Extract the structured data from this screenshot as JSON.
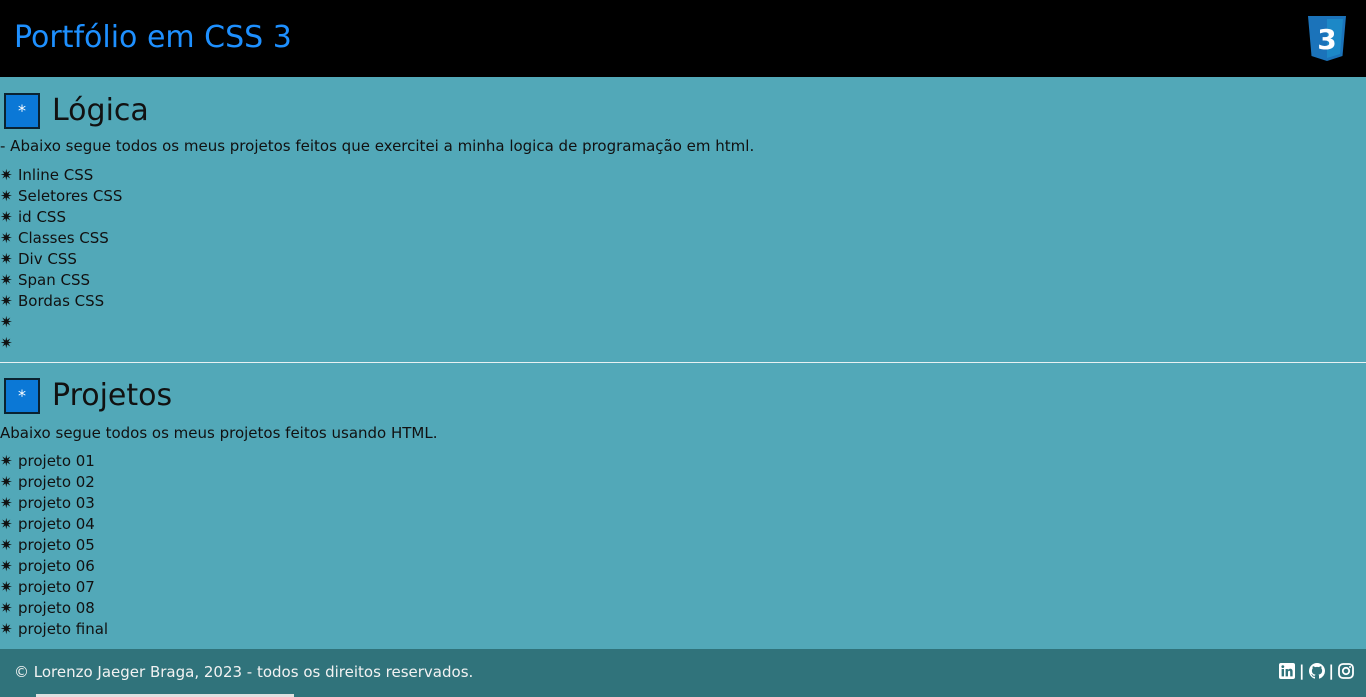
{
  "header": {
    "title": "Portfólio em CSS 3",
    "logo_icon": "css3-icon",
    "logo_text": "3"
  },
  "sections": [
    {
      "box_symbol": "*",
      "title": "Lógica",
      "description": "- Abaixo segue todos os meus projetos feitos que exercitei a minha logica de programação em html.",
      "bullet": "✷",
      "items": [
        "Inline CSS",
        "Seletores CSS",
        "id CSS",
        "Classes CSS",
        "Div CSS",
        "Span CSS",
        "Bordas CSS",
        "",
        ""
      ]
    },
    {
      "box_symbol": "*",
      "title": "Projetos",
      "description": "Abaixo segue todos os meus projetos feitos usando HTML.",
      "bullet": "✷",
      "items": [
        "projeto 01",
        "projeto 02",
        "projeto 03",
        "projeto 04",
        "projeto 05",
        "projeto 06",
        "projeto 07",
        "projeto 08",
        "projeto final"
      ]
    }
  ],
  "footer": {
    "copyright": "© Lorenzo Jaeger Braga, 2023 - todos os direitos reservados.",
    "separator": "|",
    "social_icons": [
      "linkedin-icon",
      "github-icon",
      "instagram-icon"
    ]
  },
  "colors": {
    "header_bg": "#000000",
    "title": "#1e90ff",
    "page_bg": "#52a8b8",
    "box_bg": "#0b78d6",
    "footer_bg": "#30737b"
  }
}
